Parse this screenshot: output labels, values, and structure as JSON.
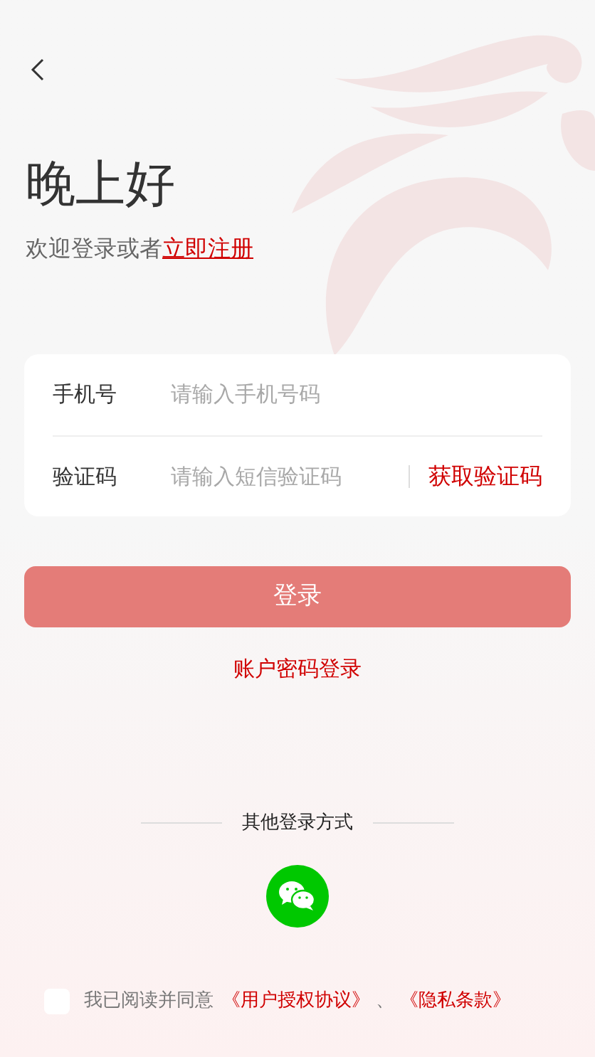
{
  "greeting": "晚上好",
  "welcome": {
    "text": "欢迎登录或者",
    "link": "立即注册"
  },
  "form": {
    "fields": [
      {
        "label": "手机号",
        "placeholder": "请输入手机号码"
      },
      {
        "label": "验证码",
        "placeholder": "请输入短信验证码",
        "action": "获取验证码"
      }
    ]
  },
  "login_button": "登录",
  "password_login_link": "账户密码登录",
  "other_login": {
    "title": "其他登录方式"
  },
  "agreement": {
    "checked": false,
    "text": "我已阅读并同意",
    "links": [
      "《用户授权协议》",
      "《隐私条款》"
    ],
    "separator": "、"
  }
}
